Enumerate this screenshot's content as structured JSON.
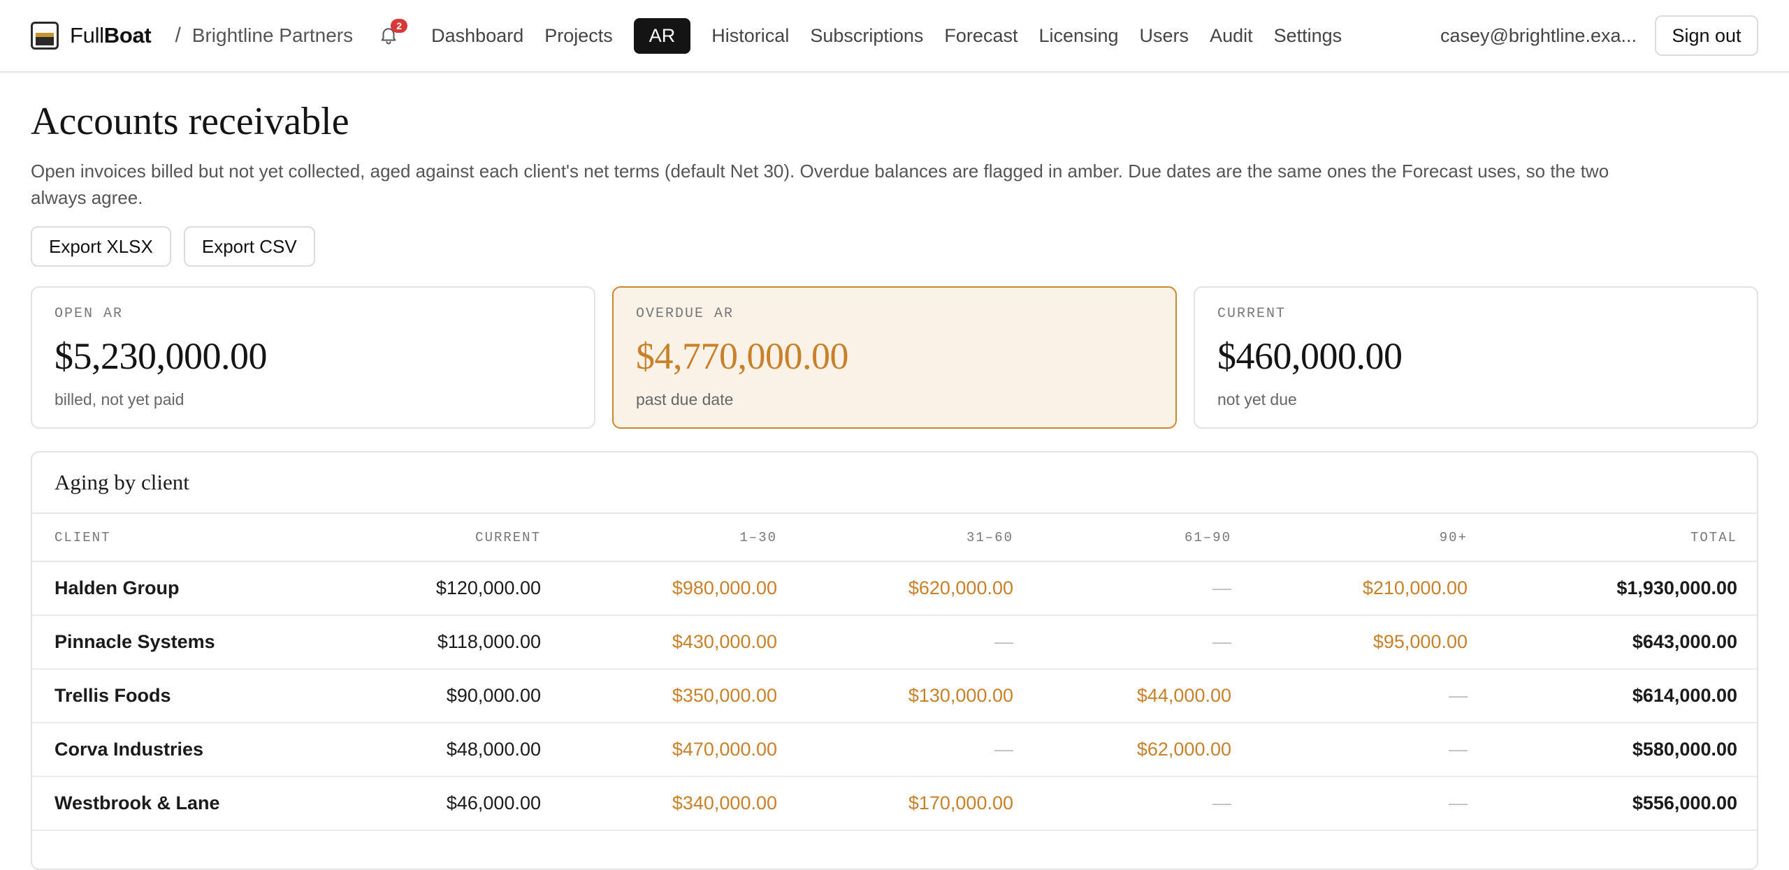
{
  "header": {
    "brand_light": "Full",
    "brand_bold": "Boat",
    "separator": "/",
    "org": "Brightline Partners",
    "notifications": "2",
    "nav": [
      {
        "label": "Dashboard"
      },
      {
        "label": "Projects"
      },
      {
        "label": "AR",
        "active": true
      },
      {
        "label": "Historical"
      },
      {
        "label": "Subscriptions"
      },
      {
        "label": "Forecast"
      },
      {
        "label": "Licensing"
      },
      {
        "label": "Users"
      },
      {
        "label": "Audit"
      },
      {
        "label": "Settings"
      }
    ],
    "user_email": "casey@brightline.exa...",
    "sign_out": "Sign out"
  },
  "page": {
    "title": "Accounts receivable",
    "description": "Open invoices billed but not yet collected, aged against each client's net terms (default Net 30). Overdue balances are flagged in amber. Due dates are the same ones the Forecast uses, so the two always agree.",
    "export_xlsx": "Export XLSX",
    "export_csv": "Export CSV"
  },
  "kpis": {
    "open": {
      "label": "OPEN AR",
      "value": "$5,230,000.00",
      "sub": "billed, not yet paid"
    },
    "overdue": {
      "label": "OVERDUE AR",
      "value": "$4,770,000.00",
      "sub": "past due date"
    },
    "current": {
      "label": "CURRENT",
      "value": "$460,000.00",
      "sub": "not yet due"
    }
  },
  "aging": {
    "title": "Aging by client",
    "columns": [
      "CLIENT",
      "CURRENT",
      "1–30",
      "31–60",
      "61–90",
      "90+",
      "TOTAL"
    ],
    "rows": [
      {
        "client": "Halden Group",
        "current": "$120,000.00",
        "d1_30": "$980,000.00",
        "d31_60": "$620,000.00",
        "d61_90": "—",
        "d90_plus": "$210,000.00",
        "total": "$1,930,000.00"
      },
      {
        "client": "Pinnacle Systems",
        "current": "$118,000.00",
        "d1_30": "$430,000.00",
        "d31_60": "—",
        "d61_90": "—",
        "d90_plus": "$95,000.00",
        "total": "$643,000.00"
      },
      {
        "client": "Trellis Foods",
        "current": "$90,000.00",
        "d1_30": "$350,000.00",
        "d31_60": "$130,000.00",
        "d61_90": "$44,000.00",
        "d90_plus": "—",
        "total": "$614,000.00"
      },
      {
        "client": "Corva Industries",
        "current": "$48,000.00",
        "d1_30": "$470,000.00",
        "d31_60": "—",
        "d61_90": "$62,000.00",
        "d90_plus": "—",
        "total": "$580,000.00"
      },
      {
        "client": "Westbrook & Lane",
        "current": "$46,000.00",
        "d1_30": "$340,000.00",
        "d31_60": "$170,000.00",
        "d61_90": "—",
        "d90_plus": "—",
        "total": "$556,000.00"
      }
    ]
  },
  "colors": {
    "overdue_amber": "#c8812a",
    "overdue_bg": "#fbf2e7",
    "active_nav_bg": "#141414",
    "badge_red": "#d93838"
  },
  "icons": {
    "logo": "fullboat-logo-icon",
    "notifications": "bell-icon"
  }
}
